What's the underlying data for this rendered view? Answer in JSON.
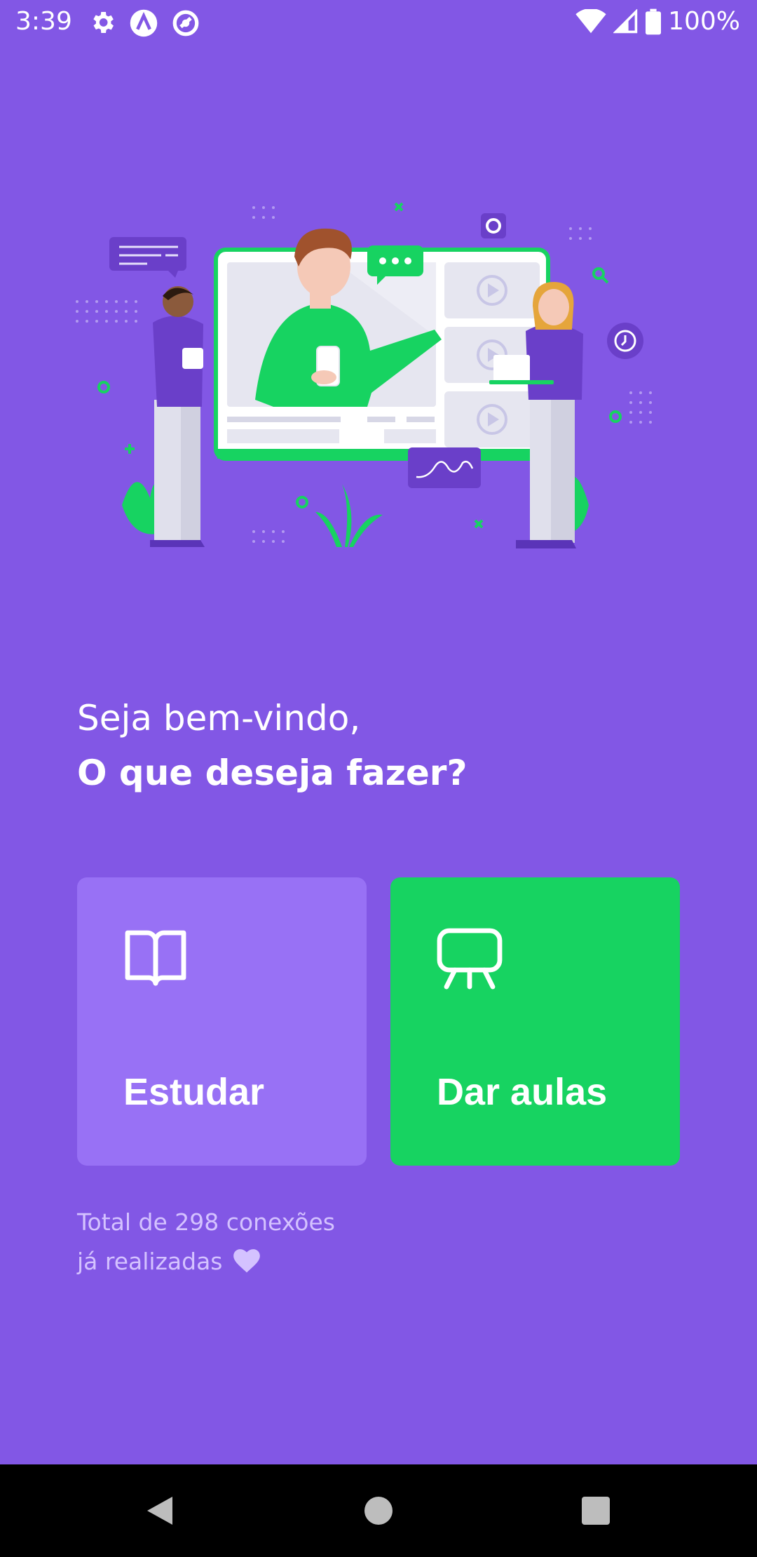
{
  "status_bar": {
    "time": "3:39",
    "battery": "100%",
    "icons": [
      "settings-gear-icon",
      "app-icon",
      "sync-icon",
      "wifi-icon",
      "signal-icon",
      "battery-icon"
    ]
  },
  "greeting": {
    "line1": "Seja bem-vindo,",
    "line2": "O que deseja fazer?"
  },
  "actions": {
    "study": {
      "label": "Estudar",
      "icon": "book-open-icon",
      "color": "#9871f5"
    },
    "teach": {
      "label": "Dar aulas",
      "icon": "presentation-board-icon",
      "color": "#17d361"
    }
  },
  "connections": {
    "line1": "Total de 298 conexões",
    "line2": "já realizadas",
    "icon": "heart-icon"
  },
  "colors": {
    "background": "#8257e5",
    "accent_green": "#17d361",
    "secondary_purple": "#9871f5"
  }
}
